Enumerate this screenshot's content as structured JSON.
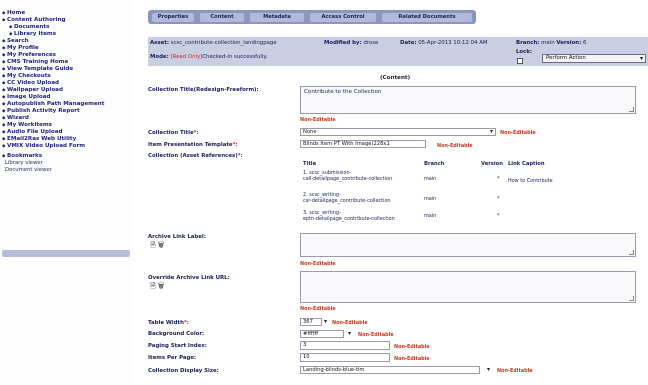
{
  "sidebar": {
    "items": [
      {
        "label": "Home",
        "level": 0
      },
      {
        "label": "Content Authoring",
        "level": 0
      },
      {
        "label": "Documents",
        "level": 1
      },
      {
        "label": "Library Items",
        "level": 1
      },
      {
        "label": "Search",
        "level": 0
      },
      {
        "label": "My Profile",
        "level": 0
      },
      {
        "label": "My Preferences",
        "level": 0
      },
      {
        "label": "CMS Training Home",
        "level": 0
      },
      {
        "label": "View Template Guide",
        "level": 0
      },
      {
        "label": "My Checkouts",
        "level": 0
      },
      {
        "label": "CC Video Upload",
        "level": 0
      },
      {
        "label": "Wallpaper Upload",
        "level": 0
      },
      {
        "label": "Image Upload",
        "level": 0
      },
      {
        "label": "Autopublish Path Management",
        "level": 0
      },
      {
        "label": "Publish Activity Report",
        "level": 0
      },
      {
        "label": "Wizard",
        "level": 0
      },
      {
        "label": "My Workitems",
        "level": 0
      },
      {
        "label": "Audio File Upload",
        "level": 0
      },
      {
        "label": "EMail2Ras Web Utility",
        "level": 0
      },
      {
        "label": "VMIX Video Upload Form",
        "level": 0
      },
      {
        "label": "Bookmarks",
        "level": 0
      },
      {
        "label": "Library viewer",
        "level": 2
      },
      {
        "label": "Document viewer",
        "level": 2
      }
    ]
  },
  "tabs": [
    "Properties",
    "Content",
    "Metadata",
    "Access Control",
    "Related Documents"
  ],
  "header": {
    "asset_label": "Asset:",
    "asset_value": "scsc_contribute-collection_landingpage",
    "modified_label": "Modified by:",
    "modified_value": "drose",
    "date_label": "Date:",
    "date_value": "05-Apr-2013 10:12:04 AM",
    "branch_label": "Branch:",
    "branch_value": "main",
    "version_label": "Version:",
    "version_value": "6",
    "mode_label": "Mode:",
    "mode_value": "[Read Only]",
    "mode_status": "Checked-in successfully.",
    "lock_label": "Lock:",
    "perform_action": "Perform Action"
  },
  "section_title": "(Content)",
  "non_editable": "Non-Editable",
  "fields": {
    "collection_title_redesign": {
      "label": "Collection Title(Redesign-Freeform):",
      "value": "Contribute to the Collection"
    },
    "collection_title": {
      "label": "Collection Title",
      "req": "*:",
      "value": "None"
    },
    "item_template": {
      "label": "Item Presentation Template",
      "req": "*:",
      "value": "Blinds Item PT With Image(228x1"
    },
    "collection_refs": {
      "label": "Collection (Asset References)",
      "req": "*:"
    },
    "archive_link_label": {
      "label": "Archive Link Label:"
    },
    "override_archive_url": {
      "label": "Override Archive Link URL:"
    },
    "table_width": {
      "label": "Table Width",
      "req": "*:",
      "value": "367"
    },
    "background_color": {
      "label": "Background Color:",
      "value": "#ffffff"
    },
    "paging_start": {
      "label": "Paging Start Index:",
      "value": "3"
    },
    "items_per_page": {
      "label": "Items Per Page:",
      "value": "10"
    },
    "display_size": {
      "label": "Collection Display Size:",
      "value": "Landing-blinds-blue-tim"
    }
  },
  "ref_table": {
    "columns": [
      "Title",
      "Branch",
      "Version",
      "Link Caption"
    ],
    "rows": [
      {
        "title_l1": "1. scsc_submission-",
        "title_l2": "call-detailpage_contribute-collection",
        "branch": "main",
        "version": "*",
        "caption": "How to Contribute"
      },
      {
        "title_l1": "2. scsc_writing-",
        "title_l2": "csr-detailpage_contribute-collection",
        "branch": "main",
        "version": "*",
        "caption": ""
      },
      {
        "title_l1": "3. scsc_writing-",
        "title_l2": "eptn-detailpage_contribute-collection",
        "branch": "main",
        "version": "*",
        "caption": ""
      }
    ]
  }
}
